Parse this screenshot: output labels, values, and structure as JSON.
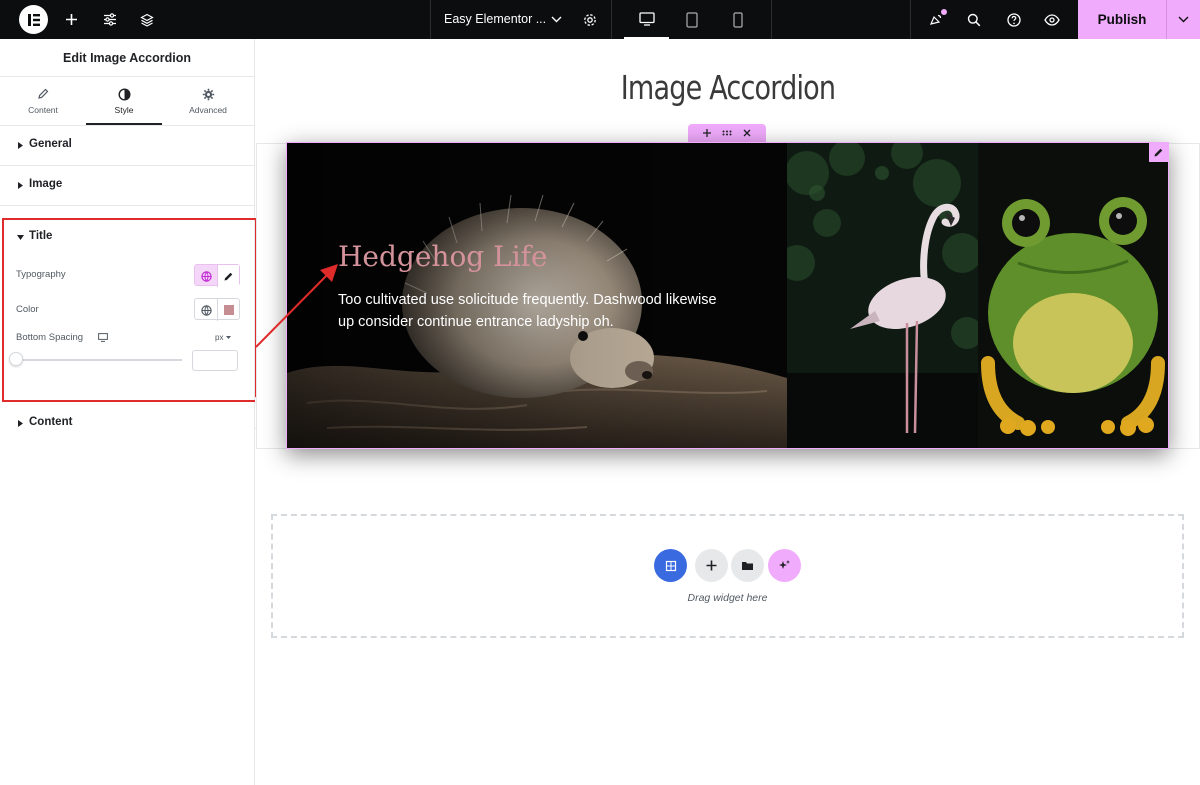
{
  "topbar": {
    "document_title": "Easy Elementor ...",
    "publish_label": "Publish",
    "icons": [
      "elementor-logo-icon",
      "add-element-icon",
      "site-settings-icon",
      "structure-layers-icon",
      "chevron-down-icon",
      "page-settings-icon",
      "desktop-icon",
      "tablet-icon",
      "mobile-icon",
      "notifications-icon",
      "search-icon",
      "help-icon",
      "preview-eye-icon"
    ],
    "active_device": "desktop",
    "accent_color": "#f0abfc"
  },
  "sidebar": {
    "panel_title": "Edit Image Accordion",
    "tabs": [
      {
        "label": "Content",
        "icon": "pencil-icon"
      },
      {
        "label": "Style",
        "icon": "half-circle-icon"
      },
      {
        "label": "Advanced",
        "icon": "gear-icon"
      }
    ],
    "active_tab": "Style",
    "sections": {
      "general": "General",
      "image": "Image",
      "title": "Title",
      "content": "Content"
    },
    "title_controls": {
      "typography_label": "Typography",
      "color_label": "Color",
      "bottom_spacing_label": "Bottom Spacing",
      "unit": "px",
      "bottom_spacing_value": "",
      "color_swatch": "#d4939a"
    }
  },
  "canvas": {
    "heading": "Image Accordion",
    "accordion": {
      "panels": [
        {
          "name": "hedgehog",
          "title": "Hedgehog Life",
          "description": "Too cultivated use solicitude frequently. Dashwood likewise\nup consider continue entrance ladyship oh."
        },
        {
          "name": "flamingo"
        },
        {
          "name": "frog"
        }
      ],
      "title_color": "#d4939a"
    },
    "drop_zone_text": "Drag widget here"
  }
}
